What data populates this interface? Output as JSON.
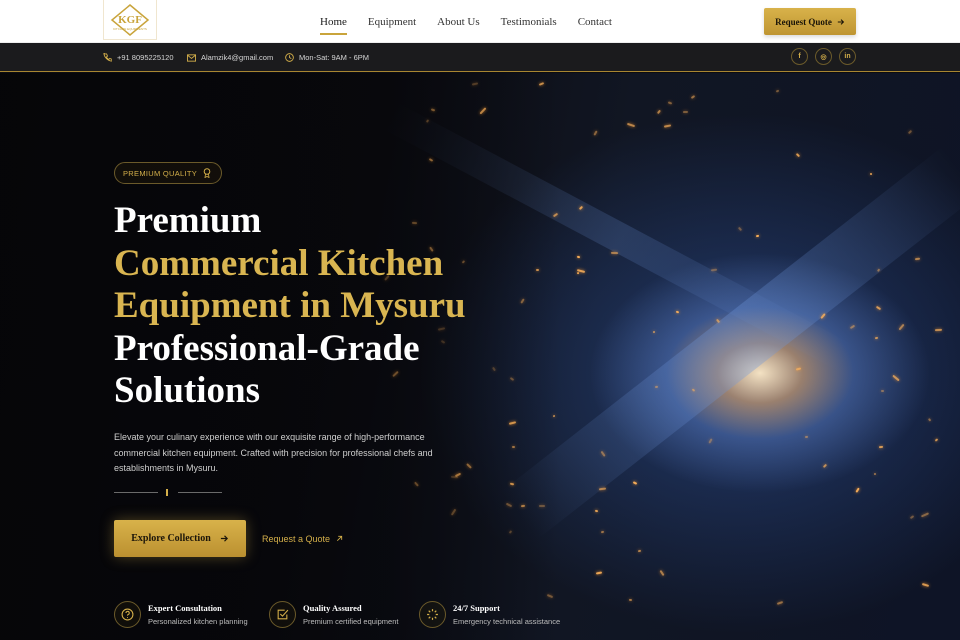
{
  "brand": {
    "logo_text": "KGF",
    "logo_subtext": "KITCHEN EQUIPMENTS"
  },
  "nav": {
    "items": [
      {
        "label": "Home",
        "active": true
      },
      {
        "label": "Equipment",
        "active": false
      },
      {
        "label": "About Us",
        "active": false
      },
      {
        "label": "Testimonials",
        "active": false
      },
      {
        "label": "Contact",
        "active": false
      }
    ],
    "cta_label": "Request Quote"
  },
  "topbar": {
    "phone": "+91 8095225120",
    "email": "Alamzik4@gmail.com",
    "hours": "Mon-Sat: 9AM - 6PM",
    "social": [
      {
        "icon": "facebook-icon",
        "glyph": "f"
      },
      {
        "icon": "instagram-icon",
        "glyph": "◎"
      },
      {
        "icon": "linkedin-icon",
        "glyph": "in"
      }
    ]
  },
  "hero": {
    "badge": "PREMIUM QUALITY",
    "title_line1": "Premium",
    "title_line2": "Commercial Kitchen",
    "title_line3": "Equipment in Mysuru",
    "title_line4": "Professional-Grade",
    "title_line5": "Solutions",
    "description": "Elevate your culinary experience with our exquisite range of high-performance commercial kitchen equipment. Crafted with precision for professional chefs and establishments in Mysuru.",
    "primary_button": "Explore Collection",
    "secondary_link": "Request a Quote"
  },
  "features": [
    {
      "title": "Expert Consultation",
      "subtitle": "Personalized kitchen planning",
      "icon": "question-icon"
    },
    {
      "title": "Quality Assured",
      "subtitle": "Premium certified equipment",
      "icon": "checkbox-icon"
    },
    {
      "title": "24/7 Support",
      "subtitle": "Emergency technical assistance",
      "icon": "loader-icon"
    }
  ],
  "colors": {
    "accent": "#d4af4a",
    "dark": "#1b1b1d",
    "nav_bg": "#ffffff"
  }
}
